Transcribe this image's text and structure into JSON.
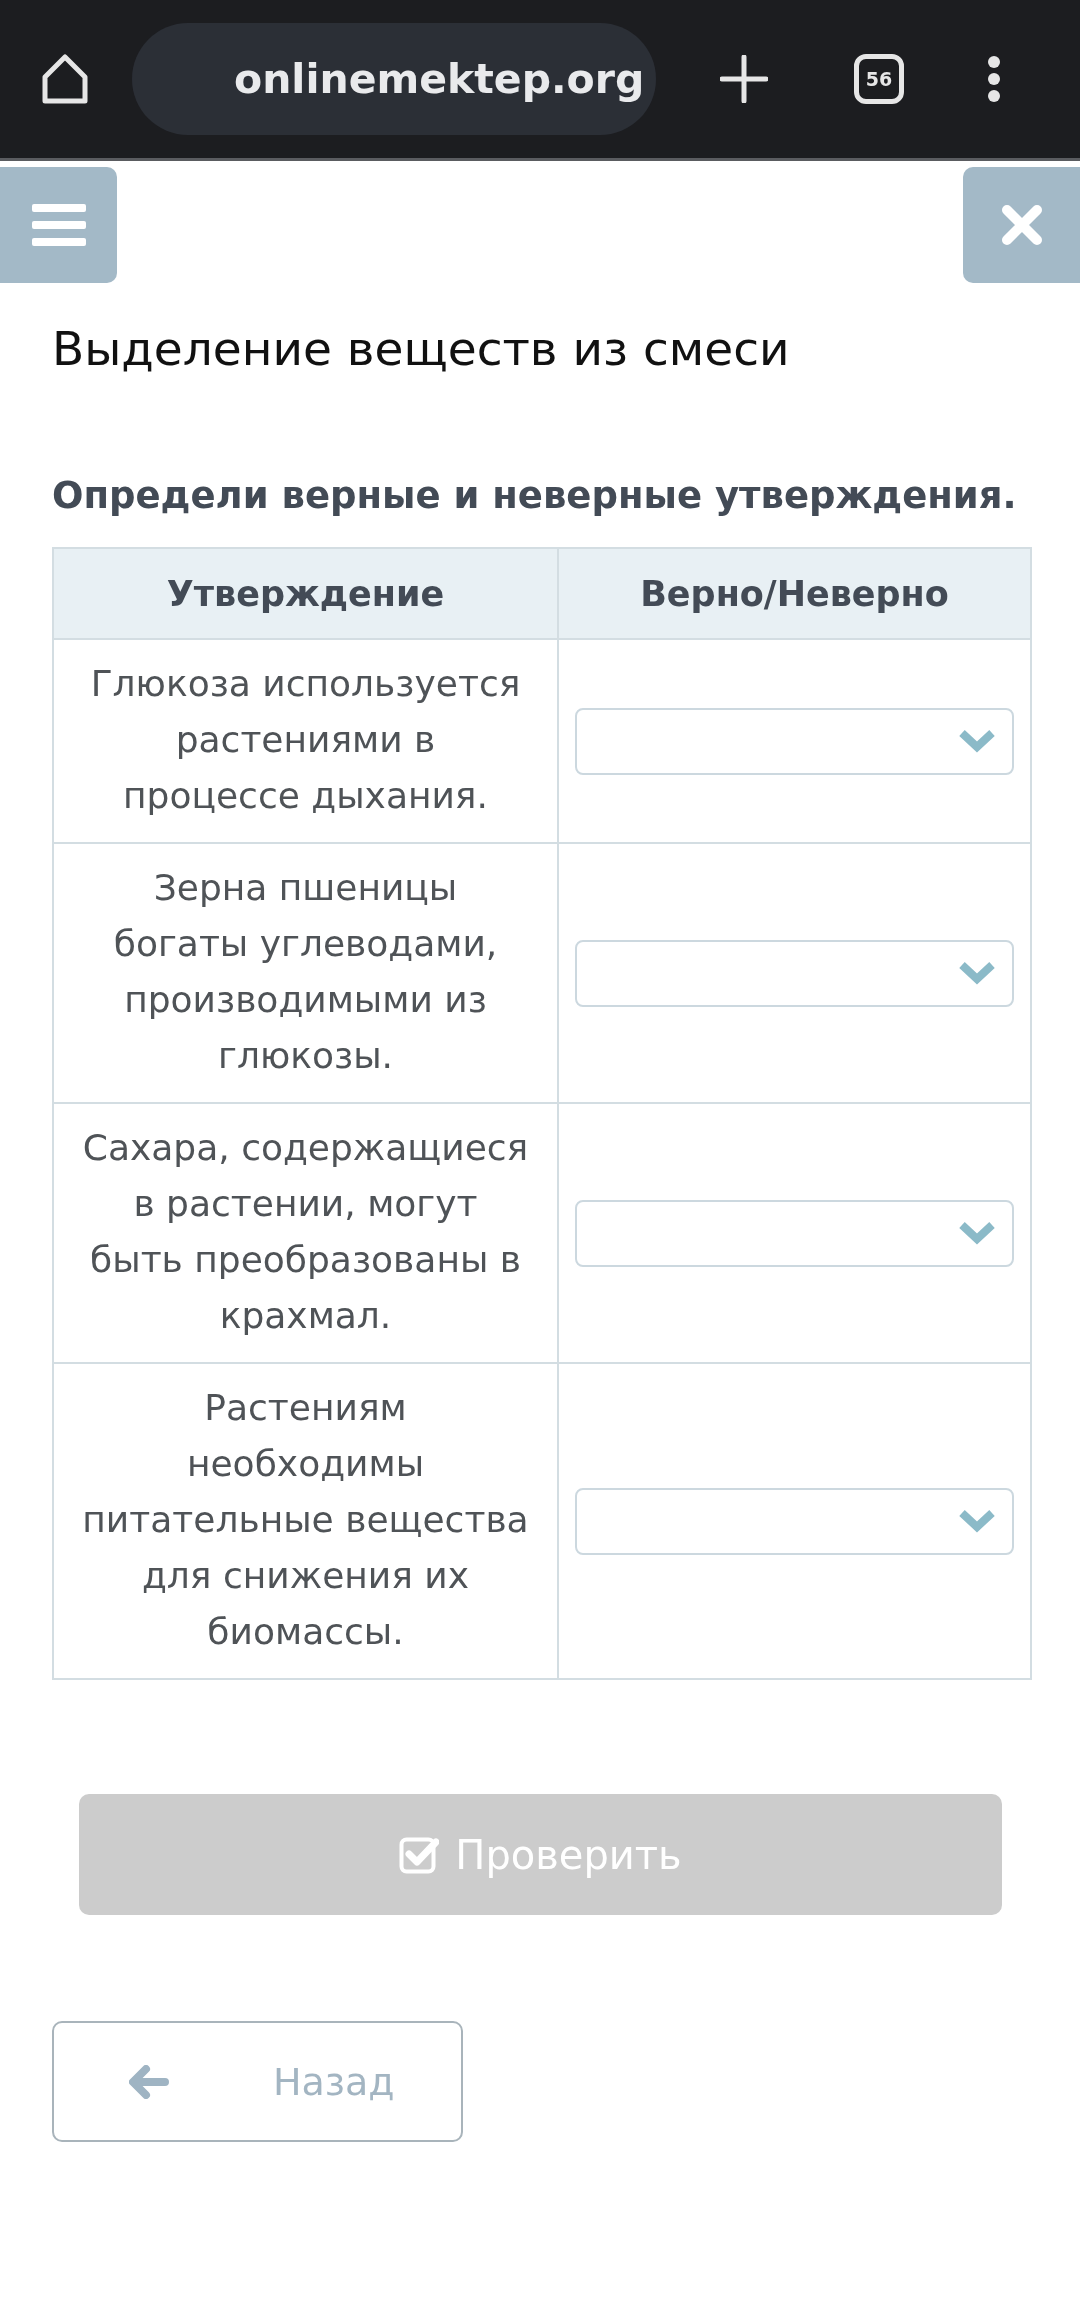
{
  "browser": {
    "url": "onlinemektep.org",
    "tab_count": "56"
  },
  "title": "Выделение веществ из смеси",
  "instruction": "Определи верные и неверные утверждения.",
  "table": {
    "columns": [
      "Утверждение",
      "Верно/Неверно"
    ],
    "rows": [
      {
        "statement": "Глюкоза используется растениями в процессе дыхания."
      },
      {
        "statement": "Зерна пшеницы богаты углеводами, производимыми из глюкозы."
      },
      {
        "statement": "Сахара, содержащиеся в растении, могут быть преобразованы в крахмал."
      },
      {
        "statement": "Растениям необходимы питательные вещества для снижения их биомассы."
      }
    ]
  },
  "check_button": {
    "label": "Проверить",
    "disabled": true
  },
  "back_button": {
    "label": "Назад"
  }
}
